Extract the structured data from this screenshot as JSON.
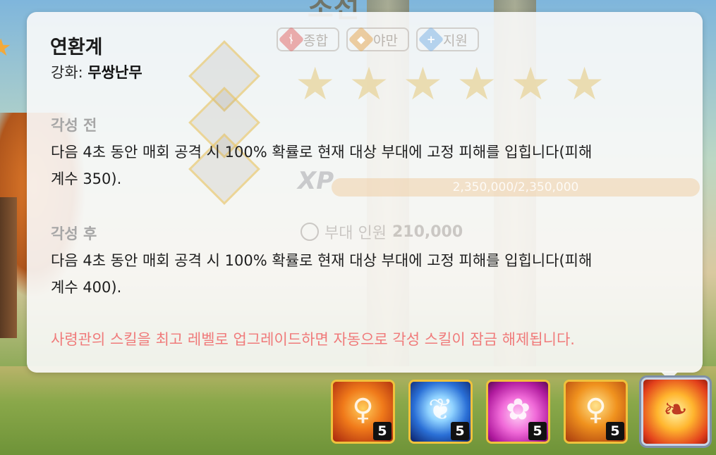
{
  "background": {
    "title_fragment": "조선",
    "class_tags": [
      {
        "label": "종합",
        "icon": "sword-icon"
      },
      {
        "label": "야만",
        "icon": "shield-icon"
      },
      {
        "label": "지원",
        "icon": "plus-icon"
      }
    ],
    "star_rating": 6,
    "xp": {
      "label": "XP",
      "text": "2,350,000/2,350,000",
      "current": 2350000,
      "max": 2350000
    },
    "troops": {
      "label": "부대 인원",
      "value": "210,000"
    }
  },
  "tooltip": {
    "title": "연환계",
    "enhance_label": "강화:",
    "enhance_value": "무쌍난무",
    "before": {
      "heading": "각성 전",
      "line1": "다음 4초 동안 매회 공격 시 100% 확률로 현재 대상 부대에 고정 피해를 입힙니다(피해",
      "line2": "계수 350)."
    },
    "after": {
      "heading": "각성 후",
      "line1": "다음 4초 동안 매회 공격 시 100% 확률로 현재 대상 부대에 고정 피해를 입힙니다(피해",
      "line2": "계수 400)."
    },
    "note": "사령관의 스킬을 최고 레벨로 업그레이드하면 자동으로 각성 스킬이 잠금 해제됩니다."
  },
  "skills": [
    {
      "name": "skill-fire-dancer",
      "level": "5",
      "icon": "fire-figure-icon",
      "selected": false
    },
    {
      "name": "skill-moon-branch",
      "level": "5",
      "icon": "moon-branch-icon",
      "selected": false
    },
    {
      "name": "skill-lotus",
      "level": "5",
      "icon": "lotus-icon",
      "selected": false
    },
    {
      "name": "skill-fire-whirl",
      "level": "5",
      "icon": "fire-whirl-icon",
      "selected": false
    },
    {
      "name": "skill-awakened-leaves",
      "level": "",
      "icon": "maple-leaf-icon",
      "selected": true
    }
  ],
  "colors": {
    "note_red": "#f07a7a",
    "heading_gray": "#a6a6a6",
    "skill_frame_gold": "#f0c23c"
  }
}
